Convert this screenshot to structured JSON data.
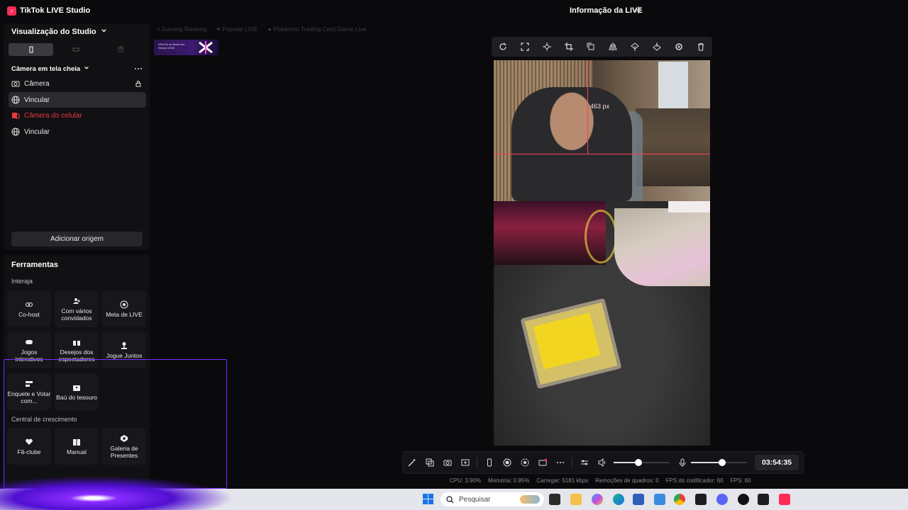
{
  "window": {
    "title": "TikTok LIVE Studio",
    "logo_glyph": "♪",
    "live_info": "Informação da LIVE"
  },
  "studio": {
    "view_title": "Visualização do Studio",
    "scene_title": "Câmera em tela cheia",
    "add_source_label": "Adicionar origem",
    "sources": [
      {
        "label": "Câmera",
        "icon": "camera-icon",
        "state": "normal"
      },
      {
        "label": "Vincular",
        "icon": "globe-icon",
        "state": "selected"
      },
      {
        "label": "Câmera do celular",
        "icon": "phone-camera-icon",
        "state": "error"
      },
      {
        "label": "Vincular",
        "icon": "globe-icon",
        "state": "normal"
      }
    ]
  },
  "tools": {
    "title": "Ferramentas",
    "interact_label": "Interaja",
    "growth_label": "Central de crescimento",
    "interact": [
      {
        "label": "Co-host",
        "icon": "link-icon"
      },
      {
        "label": "Com vários convidados",
        "icon": "multi-guest-icon"
      },
      {
        "label": "Meta de LIVE",
        "icon": "target-icon"
      },
      {
        "label": "Jogos interativos",
        "icon": "gamepad-icon"
      },
      {
        "label": "Desejos dos espectadores",
        "icon": "gift-icon"
      },
      {
        "label": "Jogue Juntos",
        "icon": "joystick-icon"
      },
      {
        "label": "Enquete e Votar com...",
        "icon": "poll-icon"
      },
      {
        "label": "Baú do tesouro",
        "icon": "chest-icon"
      }
    ],
    "growth": [
      {
        "label": "Fã-clube",
        "icon": "heart-icon"
      },
      {
        "label": "Manual",
        "icon": "book-icon"
      },
      {
        "label": "Galeria de Presentes",
        "icon": "gallery-icon"
      }
    ]
  },
  "widgets": {
    "tabs": [
      "Gaming Ranking",
      "Popular LIVE",
      "Pokémon Trading Card Game Live"
    ],
    "thumb_text": "#TikTok on Music em Shorpe 2026"
  },
  "preview": {
    "guide_label": "463 px"
  },
  "controls": {
    "timer": "03:54:35",
    "volume": 0.45,
    "mic": 0.57
  },
  "stats": [
    {
      "label": "CPU:",
      "value": "3.90%"
    },
    {
      "label": "Memória:",
      "value": "0.95%"
    },
    {
      "label": "Carregar:",
      "value": "5181 kbps"
    },
    {
      "label": "Remoções de quadros:",
      "value": "0"
    },
    {
      "label": "FPS do codificador:",
      "value": "60"
    },
    {
      "label": "FPS:",
      "value": "60"
    }
  ],
  "taskbar": {
    "search_placeholder": "Pesquisar"
  },
  "colors": {
    "accent": "#fe2c55",
    "error": "#e8373f",
    "glow": "#7a2cff"
  }
}
